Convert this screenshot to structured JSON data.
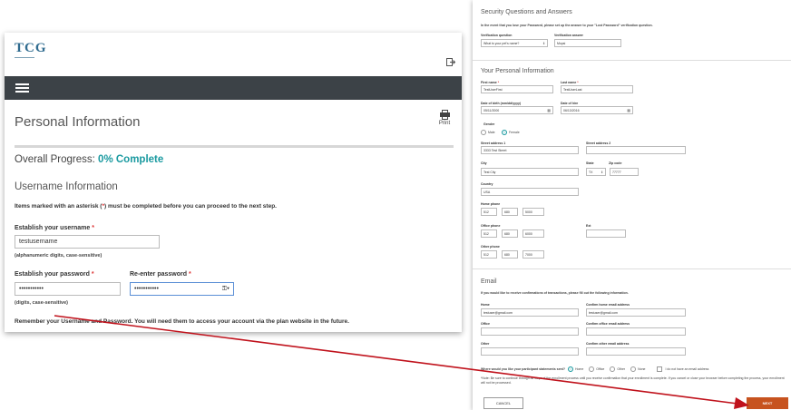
{
  "left": {
    "logo": "TCG",
    "logo_sub": "ADMINISTRATORS",
    "page_title": "Personal Information",
    "print_label": "Print",
    "progress_label": "Overall Progress:",
    "progress_value": "0% Complete",
    "progress_percent": 0,
    "section_title": "Username Information",
    "required_note_pre": "Items marked with an asterisk (",
    "required_note_ast": "*",
    "required_note_post": ") must be completed before you can proceed to the next step.",
    "username_label": "Establish your username",
    "username_value": "testusername",
    "username_hint": "(alphanumeric digits, case-sensitive)",
    "password_label": "Establish your password",
    "password_value": "•••••••••••",
    "reenter_label": "Re-enter password",
    "reenter_value": "•••••••••••",
    "password_hint": "(digits, case-sensitive)",
    "remember_text": "Remember your Username and Password. You will need them to access your account via the plan website in the future."
  },
  "right": {
    "security": {
      "title": "Security Questions and Answers",
      "intro": "In the event that you lose your Password, please set up the answer to your \"Lost Password\" verification question.",
      "question_label": "Verification question",
      "question_value": "What is your pet's name?",
      "answer_label": "Verification answer",
      "answer_value": "Mopsi"
    },
    "personal": {
      "title": "Your Personal Information",
      "first_name_label": "First name",
      "first_name_value": "TestUserFirst",
      "last_name_label": "Last name",
      "last_name_value": "TestUserLast",
      "dob_label": "Date of birth (mm/dd/yyyy)",
      "dob_value": "05/11/2000",
      "doh_label": "Date of hire",
      "doh_value": "06/13/2016",
      "gender_label": "Gender",
      "gender_male": "Male",
      "gender_female": "Female",
      "street1_label": "Street address 1",
      "street1_value": "3333 Test Street",
      "street2_label": "Street address 2",
      "city_label": "City",
      "city_value": "Test City",
      "state_label": "State",
      "state_value": "TX",
      "zip_label": "Zip code",
      "zip_value": "77777",
      "country_label": "Country",
      "country_value": "USA",
      "home_phone_label": "Home phone",
      "home_phone": [
        "512",
        "680",
        "5000"
      ],
      "office_phone_label": "Office phone",
      "office_phone": [
        "512",
        "680",
        "6000"
      ],
      "ext_label": "Ext",
      "other_phone_label": "Other phone",
      "other_phone": [
        "512",
        "680",
        "7000"
      ]
    },
    "email": {
      "title": "Email",
      "intro": "If you would like to receive confirmations of transactions, please fill out the following information.",
      "home_label": "Home",
      "home_value": "testuser@gmail.com",
      "confirm_home_label": "Confirm home email address",
      "confirm_home_value": "testuser@gmail.com",
      "office_label": "Office",
      "confirm_office_label": "Confirm office email address",
      "other_label": "Other",
      "confirm_other_label": "Confirm other email address",
      "statements_label": "Where would you like your participant statements sent?",
      "opt_home": "Home",
      "opt_office": "Office",
      "opt_other": "Other",
      "opt_none": "None",
      "no_email_label": "I do not have an email address",
      "note": "*Note: Be sure to continue through all steps of the enrollment process until you receive confirmation that your enrollment is complete. If you cancel or close your browser before completing the process, your enrollment will not be processed."
    },
    "cancel_label": "CANCEL",
    "next_label": "NEXT"
  },
  "colors": {
    "accent": "#1a9aa0",
    "navbar": "#3c4247",
    "next_button": "#c7531f",
    "arrow": "#c0121c",
    "required": "#dd3333"
  }
}
